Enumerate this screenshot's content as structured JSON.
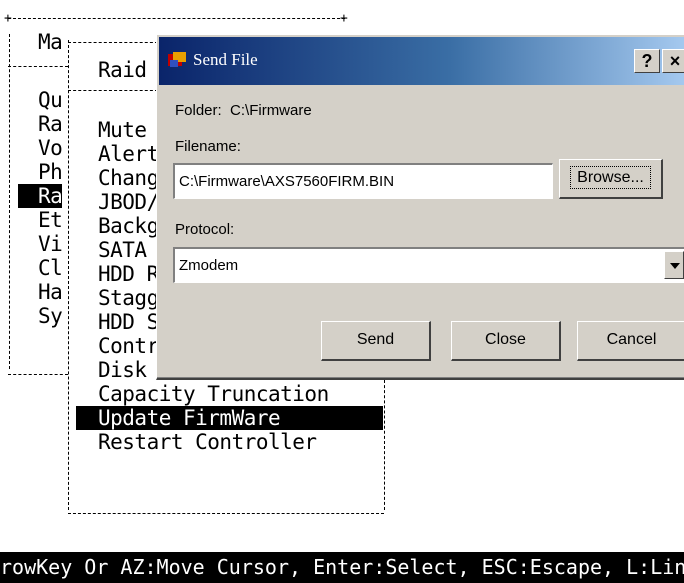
{
  "terminal": {
    "main_menu_header": "Ma",
    "main_items": [
      "Qu",
      "Ra",
      "Vo",
      "Ph",
      "Ra",
      "Et",
      "Vi",
      "Cl",
      "Ha",
      "Sy"
    ],
    "main_selected_index": 4,
    "sub_menu_header": "Raid",
    "sub_items": [
      "Mute",
      "Alert",
      "Chang",
      "JBOD/",
      "Backg",
      "SATA",
      "HDD R",
      "Stagg",
      "HDD S",
      "Contro",
      "Disk Write Cache Mode",
      "Capacity Truncation",
      "Update FirmWare",
      "Restart Controller"
    ],
    "sub_selected_index": 12
  },
  "dialog": {
    "title": "Send File",
    "help_button": "?",
    "close_button": "×",
    "folder_label": "Folder:",
    "folder_value": "C:\\Firmware",
    "filename_label": "Filename:",
    "filename_value": "C:\\Firmware\\AXS7560FIRM.BIN",
    "browse_button": "Browse...",
    "protocol_label": "Protocol:",
    "protocol_value": "Zmodem",
    "send_button": "Send",
    "close_dialog_button": "Close",
    "cancel_button": "Cancel"
  },
  "status_bar": {
    "text": "rowKey Or AZ:Move Cursor, Enter:Select, ESC:Escape, L:Line"
  },
  "colors": {
    "title_gradient_start": "#0a246a",
    "title_gradient_end": "#a6caf0",
    "dialog_bg": "#d4d0c8",
    "highlight": "#000000"
  }
}
